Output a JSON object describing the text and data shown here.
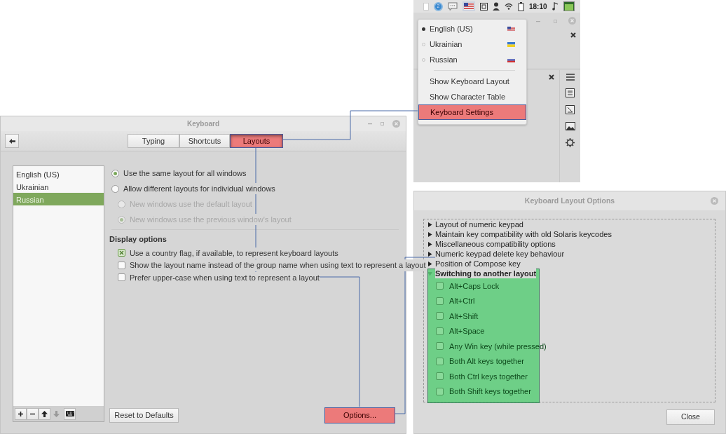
{
  "tray": {
    "badge": "2",
    "time": "18:10"
  },
  "layout_menu": {
    "layouts": [
      {
        "label": "English (US)",
        "selected": true,
        "kind": "us"
      },
      {
        "label": "Ukrainian",
        "selected": false,
        "kind": "ua"
      },
      {
        "label": "Russian",
        "selected": false,
        "kind": "ru"
      }
    ],
    "items": [
      {
        "label": "Show Keyboard Layout",
        "highlighted": false
      },
      {
        "label": "Show Character Table",
        "highlighted": false
      },
      {
        "label": "Keyboard Settings",
        "highlighted": true
      }
    ]
  },
  "keyboard_window": {
    "title": "Keyboard",
    "tabs": [
      {
        "label": "Typing",
        "selected": false,
        "highlighted": false
      },
      {
        "label": "Shortcuts",
        "selected": false,
        "highlighted": false
      },
      {
        "label": "Layouts",
        "selected": true,
        "highlighted": true
      }
    ],
    "layouts": [
      {
        "label": "English (US)",
        "selected": false
      },
      {
        "label": "Ukrainian",
        "selected": false
      },
      {
        "label": "Russian",
        "selected": true
      }
    ],
    "window_modes": [
      {
        "label": "Use the same layout for all windows",
        "selected": true,
        "disabled": false
      },
      {
        "label": "Allow different layouts for individual windows",
        "selected": false,
        "disabled": false,
        "children": [
          {
            "label": "New windows use the default layout",
            "selected": false,
            "disabled": true
          },
          {
            "label": "New windows use the previous window's layout",
            "selected": true,
            "disabled": true
          }
        ]
      }
    ],
    "display_options": {
      "heading": "Display options",
      "options": [
        {
          "label": "Use a country flag, if available,  to represent keyboard layouts",
          "checked": true
        },
        {
          "label": "Show the layout name instead of the group name when using text to represent a layout",
          "checked": false
        },
        {
          "label": "Prefer upper-case when using text to represent a layout",
          "checked": false
        }
      ]
    },
    "reset_button": "Reset to Defaults",
    "options_button": {
      "label": "Options...",
      "highlighted": true
    }
  },
  "options_dialog": {
    "title": "Keyboard Layout Options",
    "groups": [
      {
        "label": "Layout of numeric keypad",
        "expanded": false
      },
      {
        "label": "Maintain key compatibility with old Solaris keycodes",
        "expanded": false
      },
      {
        "label": "Miscellaneous compatibility options",
        "expanded": false
      },
      {
        "label": "Numeric keypad delete key behaviour",
        "expanded": false
      },
      {
        "label": "Position of Compose key",
        "expanded": false
      },
      {
        "label": "Switching to another layout",
        "expanded": true,
        "highlighted": true,
        "children": [
          {
            "label": "Alt+Caps Lock",
            "checked": false
          },
          {
            "label": "Alt+Ctrl",
            "checked": false
          },
          {
            "label": "Alt+Shift",
            "checked": false
          },
          {
            "label": "Alt+Space",
            "checked": false
          },
          {
            "label": "Any Win key (while pressed)",
            "checked": false
          },
          {
            "label": "Both Alt keys together",
            "checked": false
          },
          {
            "label": "Both Ctrl keys together",
            "checked": false
          },
          {
            "label": "Both Shift keys together",
            "checked": false
          }
        ]
      }
    ],
    "close_button": "Close"
  }
}
